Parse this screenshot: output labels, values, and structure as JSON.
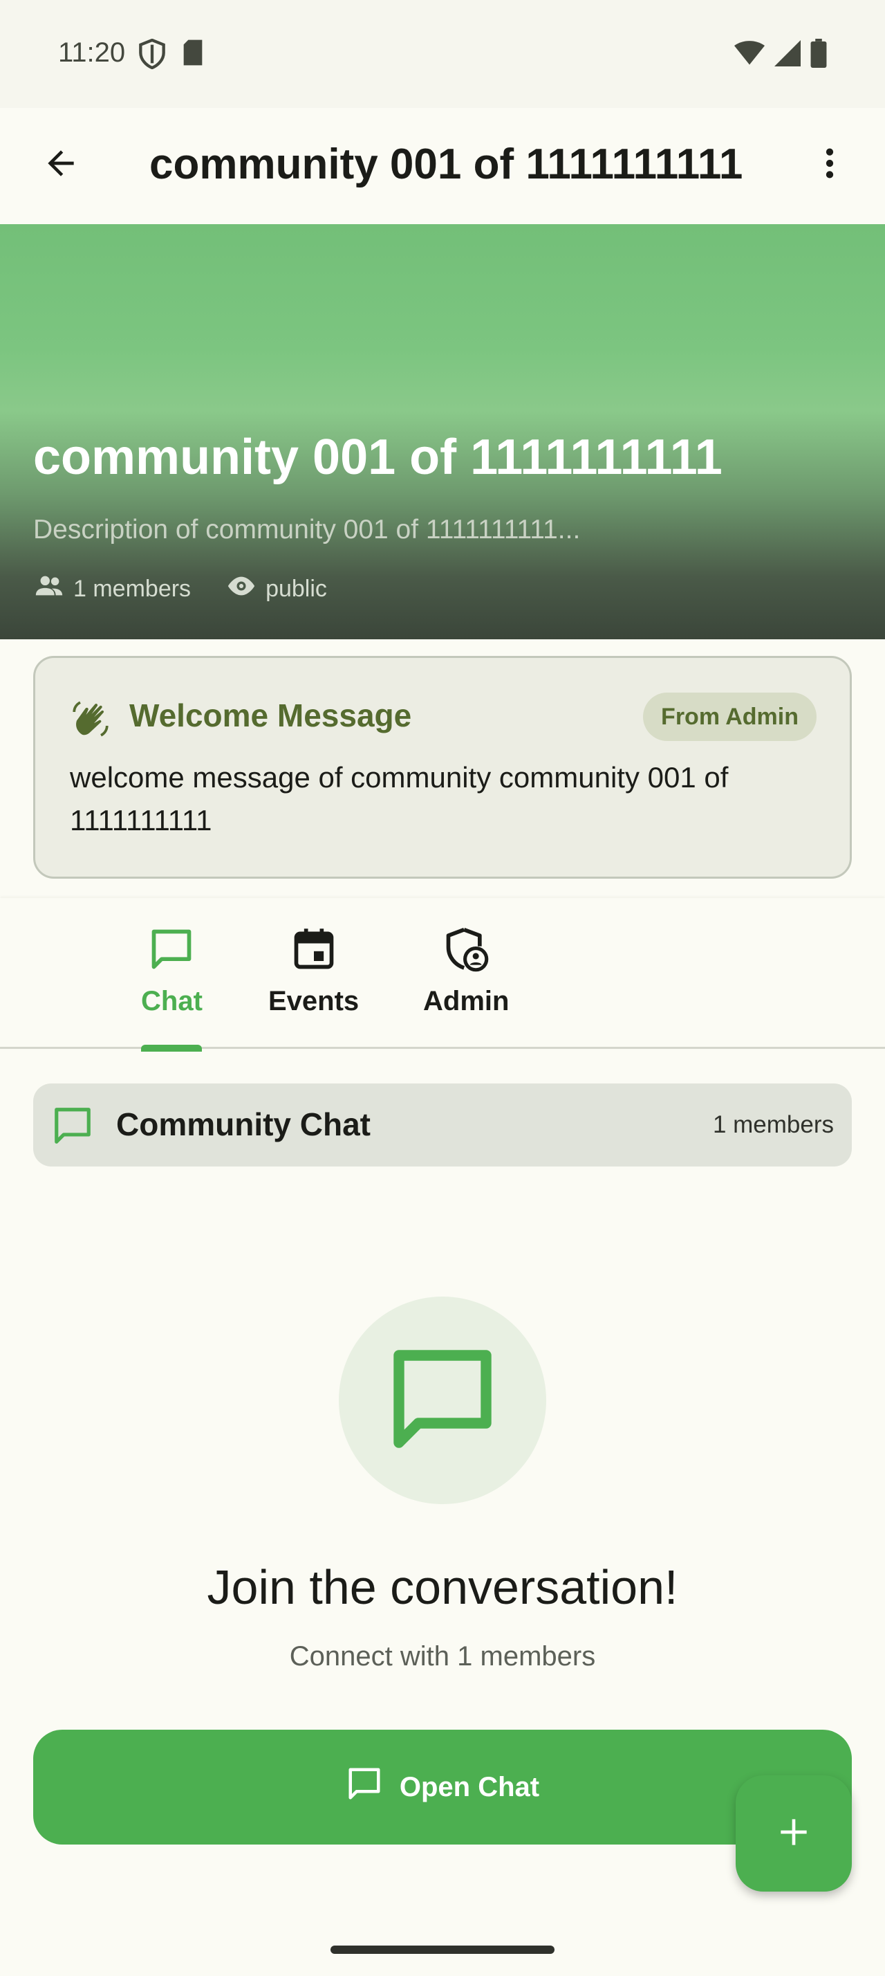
{
  "status_bar": {
    "time": "11:20"
  },
  "app_bar": {
    "title": "community 001 of 1111111111"
  },
  "hero": {
    "title": "community 001 of 1111111111",
    "description": "Description of community 001 of 1111111111...",
    "members": "1 members",
    "visibility": "public"
  },
  "welcome": {
    "title": "Welcome Message",
    "badge": "From Admin",
    "text": "welcome message of community community 001 of 1111111111"
  },
  "tabs": [
    {
      "label": "Chat",
      "icon": "chat-icon",
      "active": true
    },
    {
      "label": "Events",
      "icon": "calendar-icon",
      "active": false
    },
    {
      "label": "Admin",
      "icon": "admin-shield-icon",
      "active": false
    }
  ],
  "chat": {
    "header_title": "Community Chat",
    "header_count": "1 members",
    "empty_title": "Join the conversation!",
    "empty_subtitle": "Connect with 1 members",
    "open_button": "Open Chat"
  },
  "colors": {
    "accent": "#4caf50",
    "welcome_title": "#556b2f",
    "background": "#fbfbf4"
  }
}
